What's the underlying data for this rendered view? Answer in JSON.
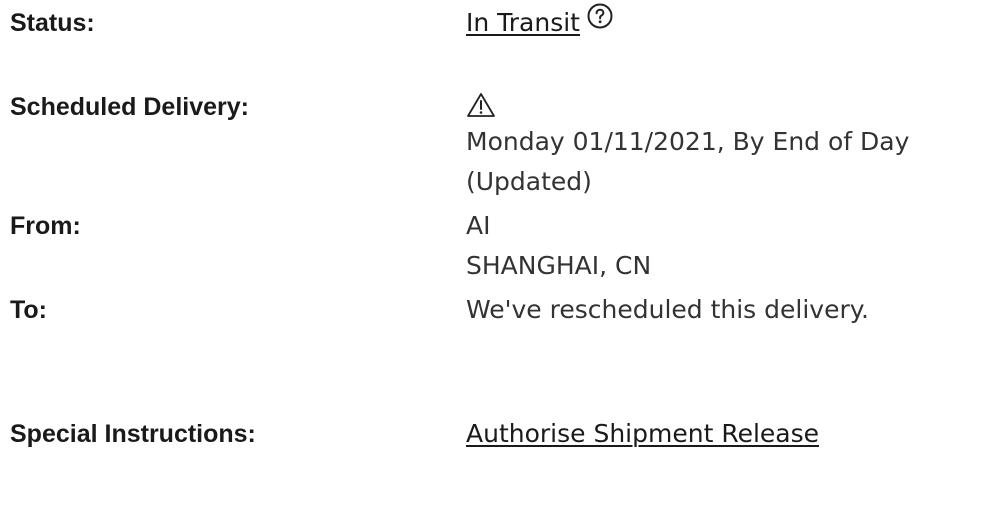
{
  "shipment": {
    "status": {
      "label": "Status:",
      "value": "In Transit",
      "help_icon": "question-circle-icon"
    },
    "scheduled_delivery": {
      "label": "Scheduled Delivery:",
      "warning_icon": "warning-triangle-icon",
      "line1": "Monday 01/11/2021, By End of Day",
      "line2": "(Updated)"
    },
    "from": {
      "label": "From:",
      "line1": "AI",
      "line2": "SHANGHAI, CN"
    },
    "to": {
      "label": "To:",
      "value": "We've rescheduled this delivery."
    },
    "special_instructions": {
      "label": "Special Instructions:",
      "link": "Authorise Shipment Release"
    }
  }
}
